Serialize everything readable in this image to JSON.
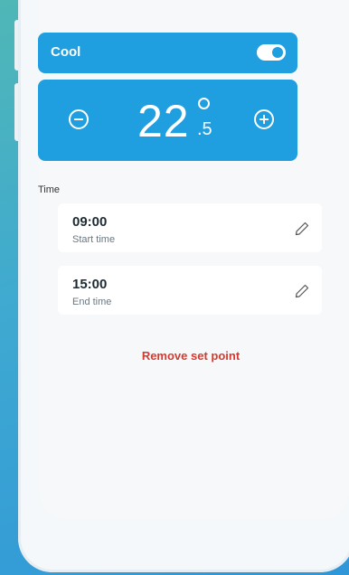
{
  "mode": {
    "label": "Cool",
    "enabled": true
  },
  "temperature": {
    "integer": "22",
    "decimal": ".5"
  },
  "time_section": {
    "label": "Time",
    "start": {
      "value": "09:00",
      "sub": "Start time"
    },
    "end": {
      "value": "15:00",
      "sub": "End time"
    }
  },
  "actions": {
    "remove_label": "Remove set point"
  },
  "colors": {
    "accent": "#1f9ee0",
    "danger": "#d43a2f"
  },
  "icons": [
    "minus-circle-icon",
    "plus-circle-icon",
    "pencil-icon",
    "toggle-switch"
  ]
}
